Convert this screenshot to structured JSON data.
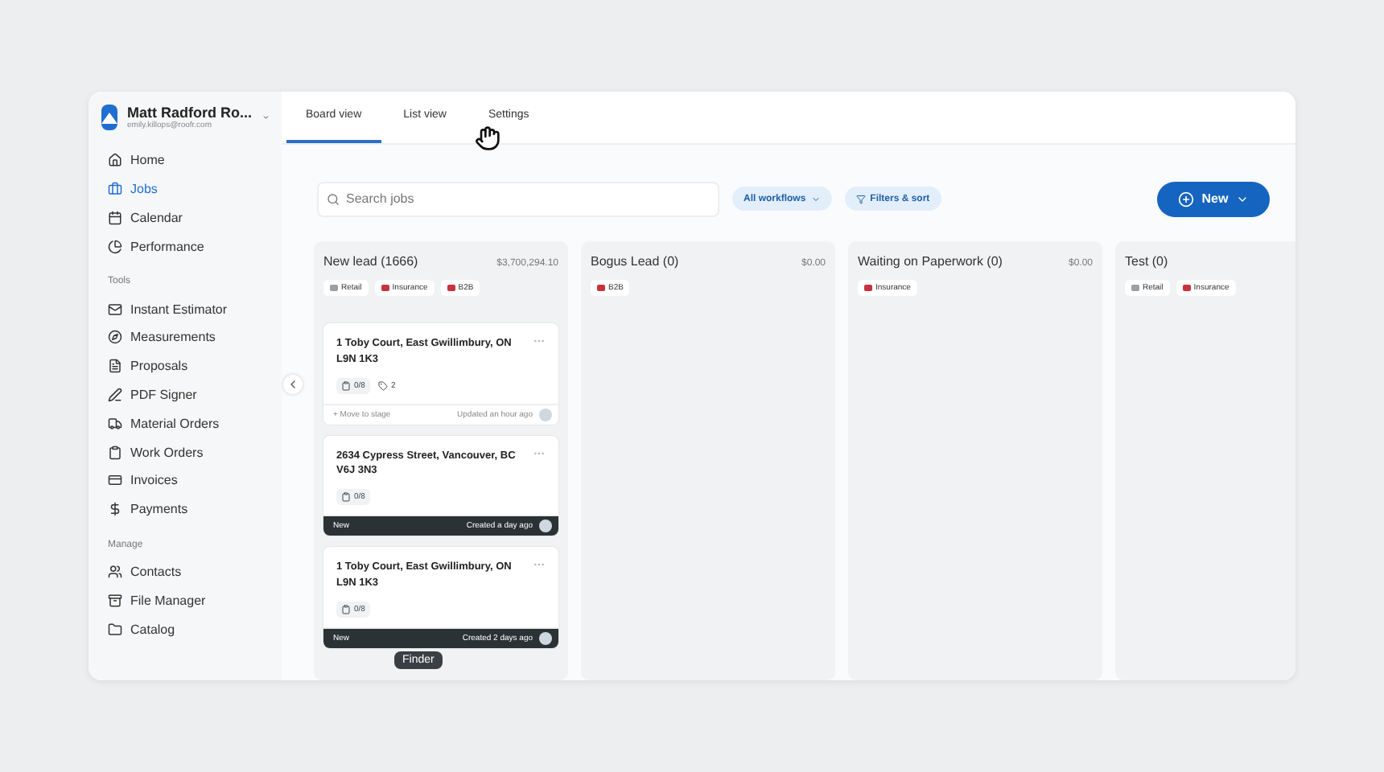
{
  "account": {
    "name": "Matt Radford Ro...",
    "email": "emily.killops@roofr.com"
  },
  "sidebar": {
    "sections": [
      {
        "items": [
          {
            "label": "Home",
            "selected": false
          },
          {
            "label": "Jobs",
            "selected": true
          },
          {
            "label": "Calendar",
            "selected": false
          },
          {
            "label": "Performance",
            "selected": false
          }
        ]
      },
      {
        "title": "Tools",
        "items": [
          {
            "label": "Instant Estimator",
            "selected": false
          },
          {
            "label": "Measurements",
            "selected": false
          },
          {
            "label": "Proposals",
            "selected": false
          },
          {
            "label": "PDF Signer",
            "selected": false
          },
          {
            "label": "Material Orders",
            "selected": false
          },
          {
            "label": "Work Orders",
            "selected": false
          },
          {
            "label": "Invoices",
            "selected": false
          },
          {
            "label": "Payments",
            "selected": false
          }
        ]
      },
      {
        "title": "Manage",
        "items": [
          {
            "label": "Contacts",
            "selected": false
          },
          {
            "label": "File Manager",
            "selected": false
          },
          {
            "label": "Catalog",
            "selected": false
          }
        ]
      }
    ]
  },
  "tabs": [
    {
      "label": "Board view",
      "selected": true
    },
    {
      "label": "List view",
      "selected": false
    },
    {
      "label": "Settings",
      "selected": false
    }
  ],
  "search": {
    "placeholder": "Search jobs"
  },
  "filters": [
    {
      "label": "All workflows",
      "kind": "dropdown"
    },
    {
      "label": "Filters & sort",
      "kind": "filter"
    }
  ],
  "new_button": {
    "label": "New"
  },
  "columns": [
    {
      "title": "New lead (1666)",
      "total": "$3,700,294.10",
      "tags": [
        {
          "label": "Retail",
          "color": "#9aa0a6"
        },
        {
          "label": "Insurance",
          "color": "#c8323c"
        },
        {
          "label": "B2B",
          "color": "#c8323c"
        }
      ],
      "cards": [
        {
          "address": "1 Toby Court, East Gwillimbury, ON L9N 1K3",
          "tasks": "0/8",
          "tag_count": "2",
          "footer_dark": false,
          "footer_left": "+ Move to stage",
          "footer_right": "Updated an hour ago"
        },
        {
          "address": "2634 Cypress Street, Vancouver, BC V6J 3N3",
          "tasks": "0/8",
          "footer_dark": true,
          "footer_left": "New",
          "footer_right": "Created a day ago"
        },
        {
          "address": "1 Toby Court, East Gwillimbury, ON L9N 1K3",
          "tasks": "0/8",
          "footer_dark": true,
          "footer_left": "New",
          "footer_right": "Created 2 days ago"
        }
      ]
    },
    {
      "title": "Bogus Lead (0)",
      "total": "$0.00",
      "tags": [
        {
          "label": "B2B",
          "color": "#c8323c"
        }
      ]
    },
    {
      "title": "Waiting on Paperwork (0)",
      "total": "$0.00",
      "tags": [
        {
          "label": "Insurance",
          "color": "#c8323c"
        }
      ]
    },
    {
      "title": "Test (0)",
      "tags": [
        {
          "label": "Retail",
          "color": "#9aa0a6"
        },
        {
          "label": "Insurance",
          "color": "#c8323c"
        }
      ]
    }
  ],
  "tooltip": {
    "label": "Finder"
  }
}
